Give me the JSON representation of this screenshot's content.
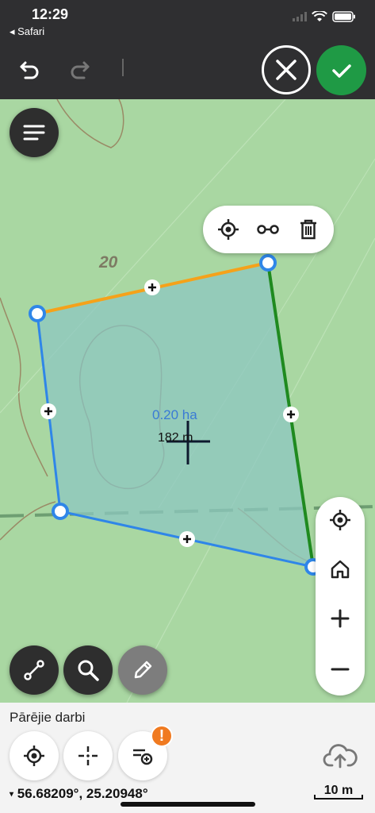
{
  "status": {
    "time": "12:29",
    "back_app": "◂ Safari"
  },
  "map": {
    "contour_label": "20",
    "area_label": "0.20 ha",
    "distance_label": "182 m"
  },
  "bottom": {
    "section_title": "Pārējie darbi",
    "coordinates": "56.68209°, 25.20948°",
    "scale_label": "10 m"
  },
  "colors": {
    "toolbar_bg": "#2f2f31",
    "confirm_green": "#1f9a45",
    "polygon_fill": "#8ec7c0",
    "edge_blue": "#2f86e8",
    "edge_orange": "#f5a21a",
    "edge_green": "#1f8a1f",
    "badge_orange": "#f07a20"
  },
  "icons": {
    "undo": "undo-icon",
    "redo": "redo-icon",
    "cancel": "close-icon",
    "confirm": "check-icon",
    "menu": "menu-icon",
    "gps": "crosshair-target-icon",
    "split": "vertex-link-icon",
    "delete": "trash-icon",
    "home": "home-icon",
    "zoom_in": "plus-icon",
    "zoom_out": "minus-icon",
    "measure": "line-measure-icon",
    "search": "search-icon",
    "edit": "pencil-icon",
    "upload": "cloud-upload-icon"
  }
}
